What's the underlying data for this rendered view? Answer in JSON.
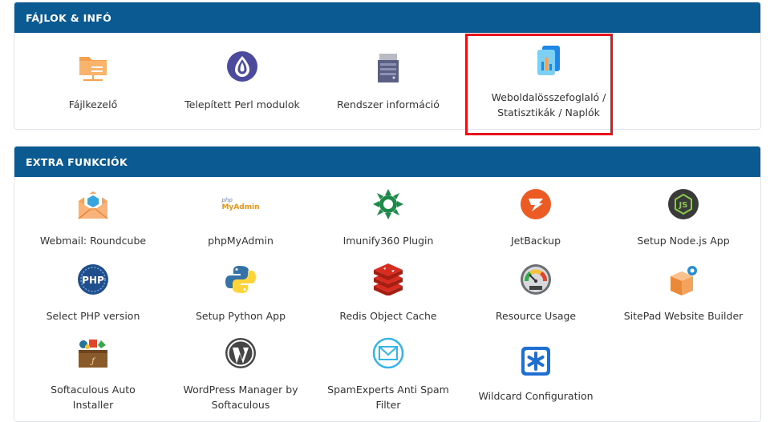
{
  "files_section": {
    "title": "FÁJLOK & INFÓ",
    "items": [
      {
        "label": "Fájlkezelő",
        "icon": "folder-icon"
      },
      {
        "label": "Telepített Perl modulok",
        "icon": "perl-onion-icon"
      },
      {
        "label": "Rendszer információ",
        "icon": "server-icon"
      },
      {
        "label_line1": "Weboldalösszefoglaló /",
        "label_line2": "Statisztikák / Naplók",
        "icon": "statistics-icon"
      }
    ]
  },
  "extra_section": {
    "title": "EXTRA FUNKCIÓK",
    "items": [
      {
        "label": "Webmail: Roundcube",
        "icon": "roundcube-mail-icon"
      },
      {
        "label": "phpMyAdmin",
        "icon": "phpmyadmin-icon",
        "logo_text_top": "php",
        "logo_text_bottom": "MyAdmin"
      },
      {
        "label": "Imunify360 Plugin",
        "icon": "imunify360-icon"
      },
      {
        "label": "JetBackup",
        "icon": "jetbackup-icon"
      },
      {
        "label": "Setup Node.js App",
        "icon": "nodejs-icon",
        "logo_text": "JS"
      },
      {
        "label": "Select PHP version",
        "icon": "php-speedometer-icon",
        "logo_text": "PHP"
      },
      {
        "label": "Setup Python App",
        "icon": "python-icon"
      },
      {
        "label": "Redis Object Cache",
        "icon": "redis-icon"
      },
      {
        "label": "Resource Usage",
        "icon": "gauge-icon"
      },
      {
        "label": "SitePad Website Builder",
        "icon": "sitepad-box-icon"
      },
      {
        "label_line1": "Softaculous Auto",
        "label_line2": "Installer",
        "icon": "softaculous-icon"
      },
      {
        "label_line1": "WordPress Manager by",
        "label_line2": "Softaculous",
        "icon": "wordpress-icon"
      },
      {
        "label_line1": "SpamExperts Anti Spam",
        "label_line2": "Filter",
        "icon": "spamexperts-envelope-icon"
      },
      {
        "label": "Wildcard Configuration",
        "icon": "wildcard-asterisk-icon"
      }
    ]
  },
  "colors": {
    "header_bg": "#0b5a91",
    "highlight_border": "#e8101a"
  }
}
